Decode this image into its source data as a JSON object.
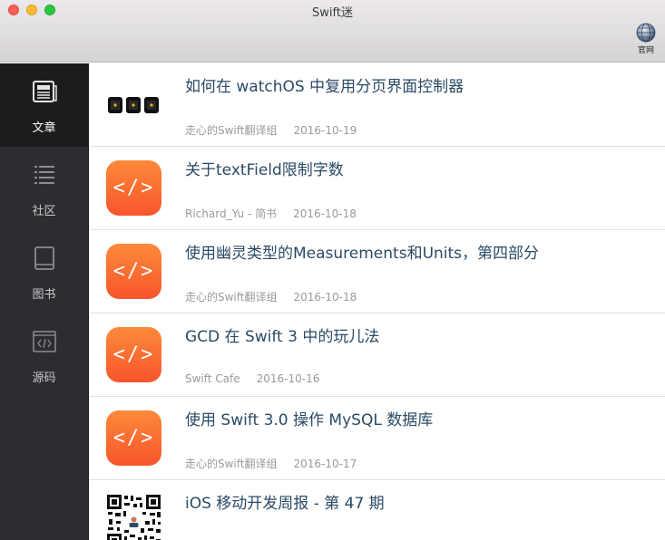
{
  "window": {
    "title": "Swift迷"
  },
  "toolbar": {
    "official_label": "官网"
  },
  "sidebar": {
    "items": [
      {
        "label": "文章",
        "icon": "newspaper-icon",
        "active": true
      },
      {
        "label": "社区",
        "icon": "list-icon",
        "active": false
      },
      {
        "label": "图书",
        "icon": "book-icon",
        "active": false
      },
      {
        "label": "源码",
        "icon": "code-icon",
        "active": false
      }
    ]
  },
  "code_glyph": "</>",
  "articles": [
    {
      "title": "如何在 watchOS 中复用分页界面控制器",
      "author": "走心的Swift翻译组",
      "date": "2016-10-19",
      "thumb": "watch-screens-icon"
    },
    {
      "title": "关于textField限制字数",
      "author": "Richard_Yu - 简书",
      "date": "2016-10-18",
      "thumb": "code-icon"
    },
    {
      "title": "使用幽灵类型的Measurements和Units，第四部分",
      "author": "走心的Swift翻译组",
      "date": "2016-10-18",
      "thumb": "code-icon"
    },
    {
      "title": "GCD 在 Swift 3 中的玩儿法",
      "author": "Swift Cafe",
      "date": "2016-10-16",
      "thumb": "code-icon"
    },
    {
      "title": "使用 Swift 3.0 操作 MySQL 数据库",
      "author": "走心的Swift翻译组",
      "date": "2016-10-17",
      "thumb": "code-icon"
    },
    {
      "title": "iOS 移动开发周报 - 第 47 期",
      "author": "",
      "date": "",
      "thumb": "qr-code-icon"
    }
  ],
  "colors": {
    "sidebar_bg": "#2c2d30",
    "title_text": "#2b4a66",
    "meta_text": "#9a9a9a",
    "code_thumb_top": "#fc8a3a",
    "code_thumb_bottom": "#f8552c"
  }
}
